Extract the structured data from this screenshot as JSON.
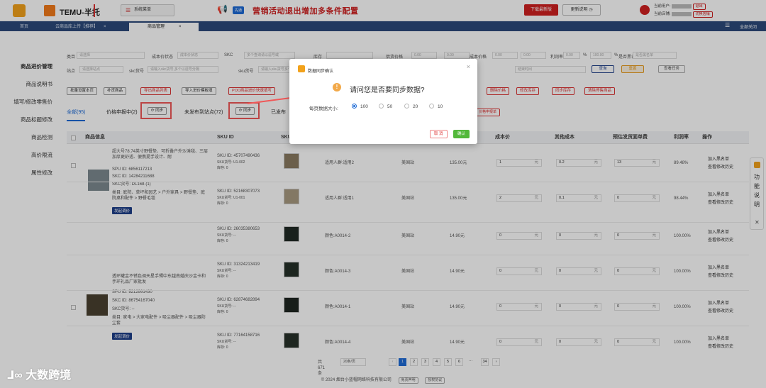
{
  "header": {
    "brand": "TEMU-半托",
    "menu_label": "系统菜单",
    "new_badge": "先通",
    "banner": "营销活动退出增加多条件配置",
    "download_label": "下载最新版",
    "update_label": "更新说明",
    "current_user_label": "当前用户:",
    "current_store_label": "当前店铺:",
    "logout_label": "退出",
    "switch_store_label": "切换店铺"
  },
  "tabs": [
    {
      "label": "首页"
    },
    {
      "label": "云商品库上传【推荐】"
    },
    {
      "label": "商品管理"
    }
  ],
  "tabbar_right": {
    "close_all": "全部关闭"
  },
  "sidebar": {
    "items": [
      {
        "label": "商品进价管理"
      },
      {
        "label": "商品说明书"
      },
      {
        "label": "填写/修改零售价"
      },
      {
        "label": "商品标题修改"
      },
      {
        "label": "商品检测"
      },
      {
        "label": "高价限流"
      },
      {
        "label": "属性修改"
      }
    ]
  },
  "filters": {
    "category_label": "类目",
    "category_ph": "请选择",
    "cost_status_label": "成本价状态",
    "cost_status_ph": "成本价状态",
    "skc_label": "SKC",
    "skc_ph": "多个查询请以逗号或",
    "stock_label": "库存",
    "supply_label": "供货价格",
    "cost_label": "成本价格",
    "profit_label": "利润率",
    "percent": "%",
    "blacklist_label": "是否黑名单",
    "blacklist_ph": "是否黑名单",
    "site_label": "站点",
    "site_ph": "请选择站点",
    "skc_code_label": "skc货号",
    "skc_code_ph": "请输入skc货号,多个以逗号分隔",
    "sku_code_label": "sku货号",
    "sku_code_ph": "请输入sku货号多个",
    "time_ph": "结束时间",
    "query": "查询",
    "reset": "重置",
    "view_tasks": "查看任务",
    "range_from": "0.00",
    "range_to": "0.00",
    "range_end": "100.00"
  },
  "actions": {
    "batch_cost": "批量设置本页",
    "import_goods": "补货商品",
    "export_list": "导出商品列表",
    "import_template": "导入进价模板填",
    "pod_fill": "POD商品进价快速填写",
    "delete_price": "删除价格",
    "modify_stock": "修改库存",
    "sync_stock": "同步库存",
    "clear_off": "清除停售商品"
  },
  "filter_tabs": {
    "all": "全部(95)",
    "pricing": "价格申报中(2)",
    "not_published": "未发布到站点(72)",
    "published": "已发布",
    "extra": "价格申报单"
  },
  "sync_label": "同步",
  "columns": {
    "product_info": "商品信息",
    "sku_id": "SKU ID",
    "sku": "SKU",
    "cost": "成本价",
    "other_cost": "其他成本",
    "shipping": "预估发货面单费",
    "profit": "利润率",
    "ops": "操作"
  },
  "products": [
    {
      "title": "超大号78.74英寸野餐垫、可折叠户外沙滩毯、三层加厚更舒适、便携提手设计、耐",
      "spu": "SPU ID: 6856117213",
      "skc": "SKC ID: 14284211688",
      "skc_code": "SKC货号: DL168-(1)",
      "cat": "类目: 庭院、草坪和园艺 > 户外家具 > 野餐垫、庭院桌和配件 > 野餐毛毯",
      "tag": "发起调价"
    },
    {
      "title": "透环罐金不锈色调天星手镯中东越南婚庆沙金卡和手环礼品厂家批发",
      "spu": "SPU ID: 5212991430",
      "skc": "SKC ID: 86754167040",
      "skc_code": "SKC货号: --",
      "cat": "类目: 家电 > 大家电配件 > 吸尘器配件 > 吸尘器防尘套",
      "tag": "发起调价"
    }
  ],
  "rows": [
    {
      "sku_id": "SKU ID: 45707490436",
      "sku_code": "SKU货号: U1-002",
      "stock": "库存: 0",
      "attr": "适用人群:适用2",
      "site": "美国站",
      "price": "135.00元",
      "cost": "1",
      "unit": "元",
      "other": "0.2",
      "ship": "13",
      "profit": "89.48%"
    },
    {
      "sku_id": "SKU ID: 52168307073",
      "sku_code": "SKU货号: U1-001",
      "stock": "库存: 0",
      "attr": "适用人群:适用1",
      "site": "美国站",
      "price": "135.00元",
      "cost": "2",
      "unit": "元",
      "other": "0.1",
      "ship": "0",
      "profit": "98.44%"
    },
    {
      "sku_id": "SKU ID: 26035380653",
      "sku_code": "SKU货号: --",
      "stock": "库存: 0",
      "attr": "颜色:A0014-2",
      "site": "美国站",
      "price": "14.90元",
      "cost": "0",
      "unit": "元",
      "other": "0",
      "ship": "0",
      "profit": "100.00%"
    },
    {
      "sku_id": "SKU ID: 31324213419",
      "sku_code": "SKU货号: --",
      "stock": "库存: 0",
      "attr": "颜色:A0014-3",
      "site": "美国站",
      "price": "14.90元",
      "cost": "0",
      "unit": "元",
      "other": "0",
      "ship": "0",
      "profit": "100.00%"
    },
    {
      "sku_id": "SKU ID: 62874682894",
      "sku_code": "SKU货号: --",
      "stock": "库存: 0",
      "attr": "颜色:A0014-1",
      "site": "美国站",
      "price": "14.90元",
      "cost": "0",
      "unit": "元",
      "other": "0",
      "ship": "0",
      "profit": "100.00%"
    },
    {
      "sku_id": "SKU ID: 77164158716",
      "sku_code": "SKU货号: --",
      "stock": "库存: 0",
      "attr": "颜色:A0014-4",
      "site": "美国站",
      "price": "14.90元",
      "cost": "0",
      "unit": "元",
      "other": "0",
      "ship": "0",
      "profit": "100.00%"
    }
  ],
  "ops": {
    "blacklist": "加入黑名单",
    "history": "查看修改历史"
  },
  "pager": {
    "total": "共 671 条",
    "size": "20条/页",
    "pages": [
      "1",
      "2",
      "3",
      "4",
      "5",
      "6",
      "···",
      "34"
    ]
  },
  "footer": {
    "copyright": "© 2024 烟台小蓝帽网络科技有限公司",
    "disclaimer": "免责声明",
    "license": "授权协议"
  },
  "dialog": {
    "title": "数据同步确认",
    "question": "请问您是否要同步数据?",
    "page_size_label": "每页数据大小:",
    "options": [
      "100",
      "50",
      "20",
      "10"
    ],
    "selected": "100",
    "cancel": "取 消",
    "confirm": "确认"
  },
  "helper": {
    "text": "功能说明"
  },
  "watermark": "大数跨境"
}
